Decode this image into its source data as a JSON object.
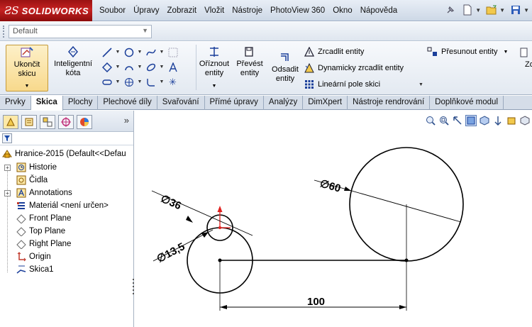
{
  "app": {
    "brand_mark": "ƧS",
    "brand_name": "SOLIDWORKS"
  },
  "menu": [
    "Soubor",
    "Úpravy",
    "Zobrazit",
    "Vložit",
    "Nástroje",
    "PhotoView 360",
    "Okno",
    "Nápověda"
  ],
  "configuration": {
    "value": "Default"
  },
  "commands": {
    "exit_sketch": [
      "Ukončit",
      "skicu"
    ],
    "smart_dimension": [
      "Inteligentní",
      "kóta"
    ],
    "trim": [
      "Oříznout",
      "entity"
    ],
    "convert": [
      "Převést",
      "entity"
    ],
    "offset": [
      "Odsadit",
      "entity"
    ],
    "mirror": "Zrcadlit entity",
    "dynamic_mirror": "Dynamicky zrcadlit entity",
    "linear_pattern": "Lineární pole skici",
    "move": "Přesunout entity",
    "cut_off": "Zo"
  },
  "tabs": [
    "Prvky",
    "Skica",
    "Plochy",
    "Plechové díly",
    "Svařování",
    "Přímé úpravy",
    "Analýzy",
    "DimXpert",
    "Nástroje rendrování",
    "Doplňkové modul"
  ],
  "active_tab": "Skica",
  "tree": {
    "root": "Hranice-2015  (Default<<Defau",
    "items": [
      "Historie",
      "Čidla",
      "Annotations",
      "Materiál <není určen>",
      "Front Plane",
      "Top Plane",
      "Right Plane",
      "Origin",
      "Skica1"
    ]
  },
  "sketch": {
    "dims": {
      "small_outer": "36",
      "small_inner": "13,5",
      "large": "60",
      "distance": "100"
    },
    "diameter_symbol": "∅"
  },
  "colors": {
    "brand_red": "#b51a1a",
    "highlight": "#f8d98c",
    "origin_red": "#e0201e"
  },
  "icons": {
    "panel_tabs": [
      "feature-manager-icon",
      "property-manager-icon",
      "configuration-manager-icon",
      "dimxpert-icon",
      "appearance-icon"
    ],
    "view_toolbar": [
      "zoom-to-fit-icon",
      "zoom-area-icon",
      "previous-view-icon",
      "section-view-icon",
      "view-orientation-icon",
      "display-style-icon",
      "hide-show-icon",
      "edit-appearance-icon",
      "scene-icon"
    ]
  }
}
